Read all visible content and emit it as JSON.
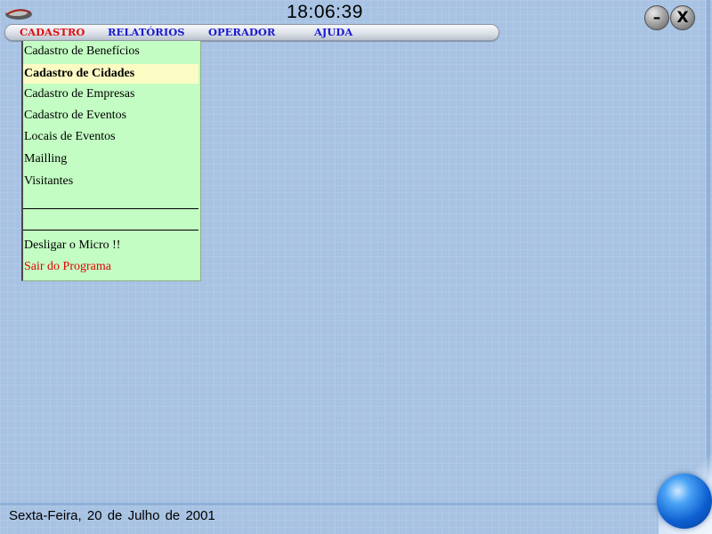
{
  "clock": {
    "time": "18:06:39"
  },
  "menubar": {
    "items": [
      {
        "label": "CADASTRO",
        "active": true
      },
      {
        "label": "RELATÓRIOS"
      },
      {
        "label": "OPERADOR"
      },
      {
        "label": "AJUDA"
      }
    ]
  },
  "dropdown": {
    "items": [
      {
        "label": "Cadastro de Benefícios"
      },
      {
        "label": "Cadastro de Cidades",
        "highlighted": true
      },
      {
        "label": "Cadastro de Empresas"
      },
      {
        "label": "Cadastro de Eventos"
      },
      {
        "label": "Locais de Eventos"
      },
      {
        "label": "Mailling"
      },
      {
        "label": "Visitantes"
      },
      {
        "label": "Desligar o Micro !!"
      },
      {
        "label": "Sair do Programa",
        "color": "#e00000"
      }
    ]
  },
  "window_buttons": {
    "minimize": "–",
    "close": "X"
  },
  "status": {
    "date": "Sexta-Feira, 20 de Julho de 2001"
  },
  "icons": {
    "logo": "app-logo-icon",
    "orb": "blue-orb-icon"
  },
  "colors": {
    "background": "#a7c2e2",
    "menu_active": "#e01010",
    "menu_text": "#1a1ad0",
    "dropdown_bg": "#c3fdc3",
    "highlight_bg": "#fbfbc4"
  }
}
